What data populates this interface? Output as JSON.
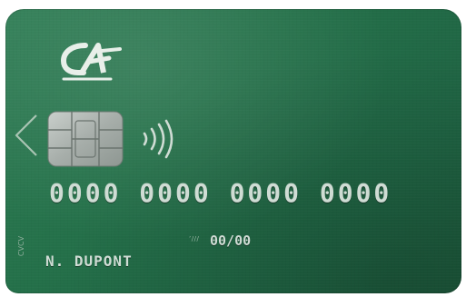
{
  "card": {
    "background_color": "#247049",
    "number": "0000 0000 0000 0000",
    "expiry_label": "’///",
    "expiry": "00/00",
    "holder": "N. DUPONT",
    "side_code": "CVCV"
  },
  "logo": {
    "icon": "ca-logo-icon",
    "mark": "CA"
  },
  "icons": {
    "arrow": "left-arrow-icon",
    "chip": "chip-icon",
    "contactless": "contactless-icon"
  }
}
